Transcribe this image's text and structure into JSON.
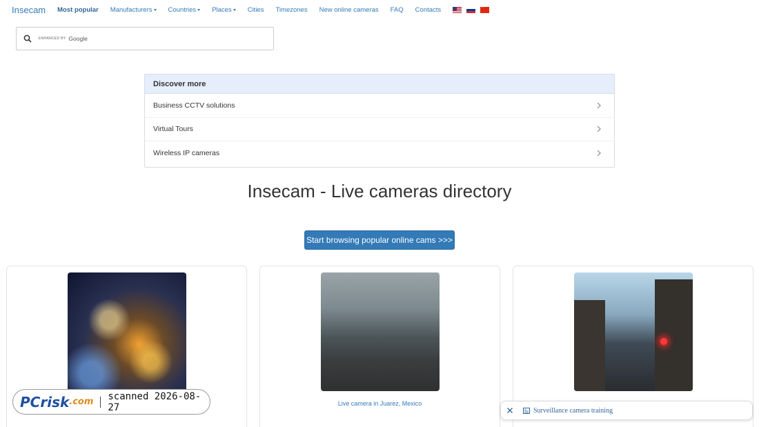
{
  "nav": {
    "brand": "Insecam",
    "items": [
      {
        "label": "Most popular",
        "bold": true,
        "caret": false
      },
      {
        "label": "Manufacturers",
        "caret": true
      },
      {
        "label": "Countries",
        "caret": true
      },
      {
        "label": "Places",
        "caret": true
      },
      {
        "label": "Cities",
        "caret": false
      },
      {
        "label": "Timezones",
        "caret": false
      },
      {
        "label": "New online cameras",
        "caret": false
      },
      {
        "label": "FAQ",
        "caret": false
      },
      {
        "label": "Contacts",
        "caret": false
      }
    ],
    "flags": [
      "us-flag-icon",
      "ru-flag-icon",
      "cn-flag-icon"
    ]
  },
  "search": {
    "enhanced_by": "ENHANCED BY",
    "provider": "Google"
  },
  "discover": {
    "title": "Discover more",
    "items": [
      "Business CCTV solutions",
      "Virtual Tours",
      "Wireless IP cameras"
    ]
  },
  "main": {
    "title": "Insecam - Live cameras directory",
    "cta": "Start browsing popular online cams >>>"
  },
  "cards": [
    {
      "caption": ""
    },
    {
      "caption": "Live camera in Juarez, Mexico"
    },
    {
      "caption": ""
    }
  ],
  "watermark": {
    "logo_pc": "PC",
    "logo_risk": "risk",
    "logo_com": ".com",
    "scanned": "scanned 2026-08-27"
  },
  "popup": {
    "text": "Surveillance camera training"
  },
  "colors": {
    "link": "#337ab7",
    "button": "#337ab7",
    "discover_header": "#e5eefa"
  }
}
